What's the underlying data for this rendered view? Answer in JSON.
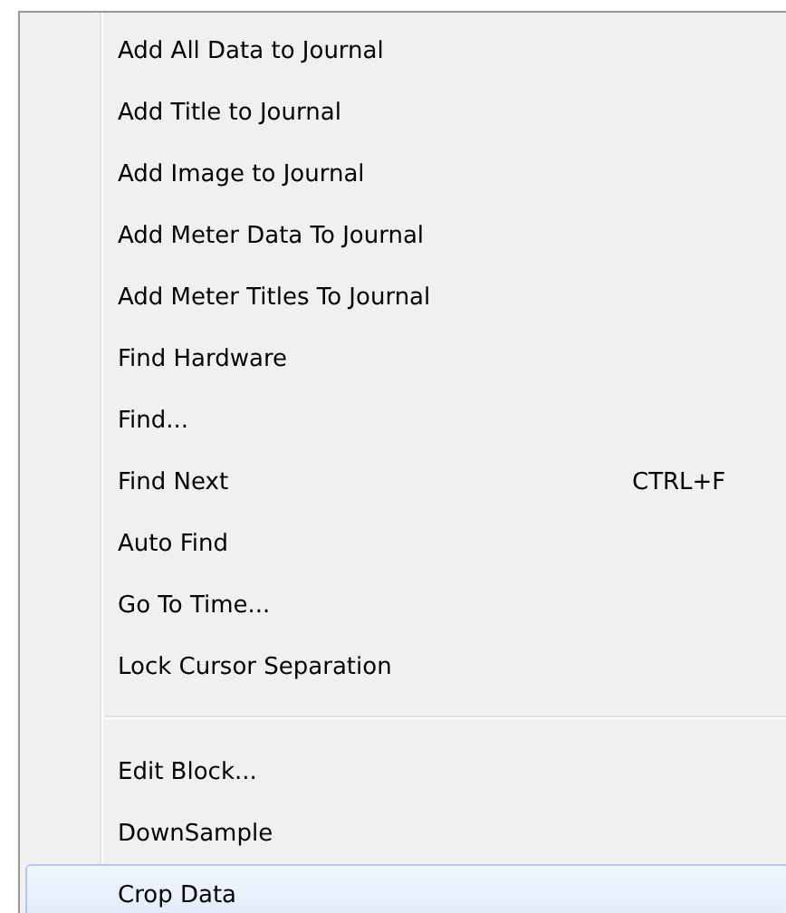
{
  "menu": {
    "groups": [
      [
        {
          "label": "Add All Data to Journal",
          "selected": false
        },
        {
          "label": "Add Title to Journal",
          "selected": false
        },
        {
          "label": "Add Image to Journal",
          "selected": false
        },
        {
          "label": "Add Meter Data To Journal",
          "selected": false
        },
        {
          "label": "Add Meter Titles To Journal",
          "selected": false
        },
        {
          "label": "Find Hardware",
          "selected": false
        },
        {
          "label": "Find...",
          "selected": false
        },
        {
          "label": "Find Next",
          "shortcut": "CTRL+F",
          "selected": false
        },
        {
          "label": "Auto Find",
          "selected": false
        },
        {
          "label": "Go To Time...",
          "selected": false
        },
        {
          "label": "Lock Cursor Separation",
          "selected": false
        }
      ],
      [
        {
          "label": "Edit Block...",
          "selected": false
        },
        {
          "label": "DownSample",
          "selected": false
        },
        {
          "label": "Crop Data",
          "selected": true
        }
      ]
    ]
  }
}
